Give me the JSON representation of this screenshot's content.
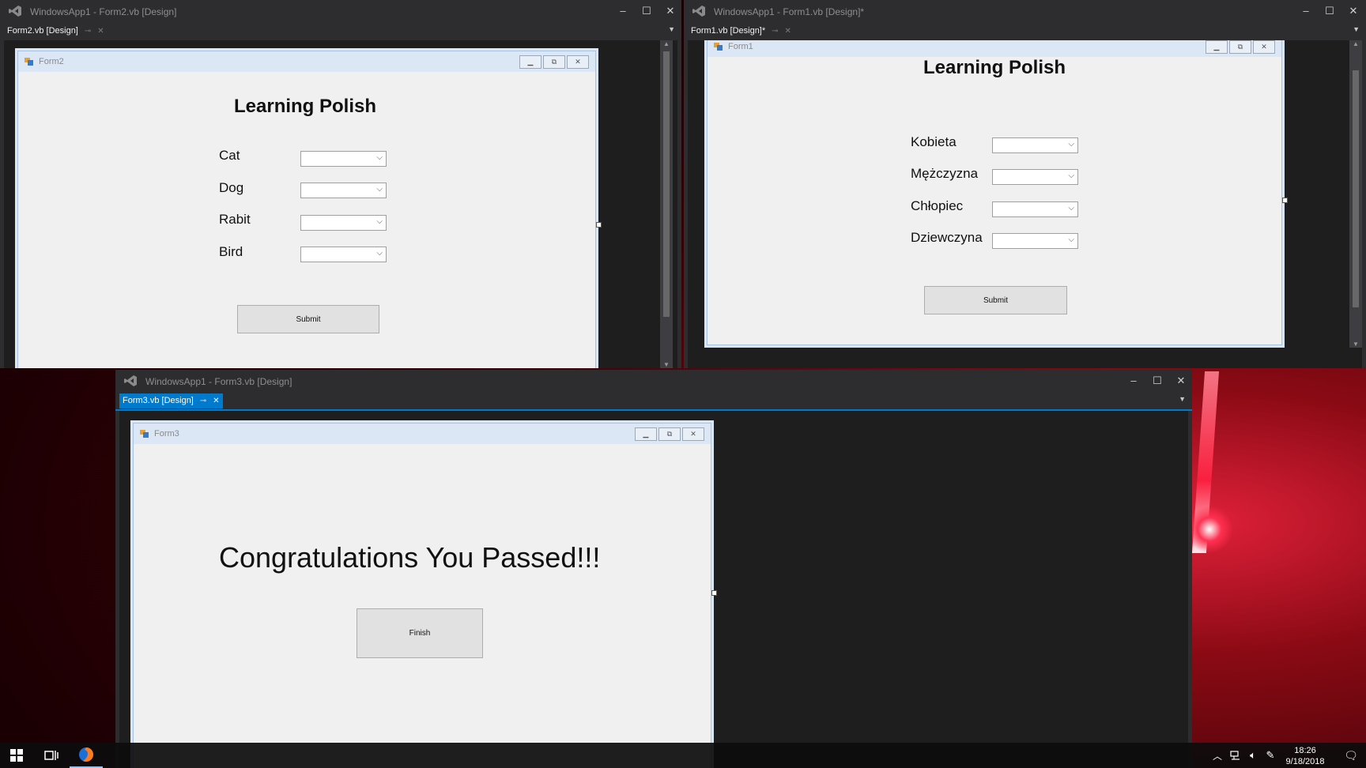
{
  "win_form2": {
    "title": "WindowsApp1 - Form2.vb [Design]",
    "tab": "Form2.vb [Design]",
    "form": {
      "name": "Form2",
      "heading": "Learning Polish",
      "labels": [
        "Cat",
        "Dog",
        "Rabit",
        "Bird"
      ],
      "submit": "Submit"
    }
  },
  "win_form1": {
    "title": "WindowsApp1 - Form1.vb [Design]*",
    "tab": "Form1.vb [Design]*",
    "form": {
      "name": "Form1",
      "heading": "Learning Polish",
      "labels": [
        "Kobieta",
        "Mężczyzna",
        "Chłopiec",
        "Dziewczyna"
      ],
      "submit": "Submit"
    }
  },
  "win_form3": {
    "title": "WindowsApp1 - Form3.vb [Design]",
    "tab": "Form3.vb [Design]",
    "form": {
      "name": "Form3",
      "heading": "Congratulations You Passed!!!",
      "finish": "Finish"
    }
  },
  "window_controls": {
    "minimize": "‒",
    "maximize": "☐",
    "close": "✕"
  },
  "taskbar": {
    "time": "18:26",
    "date": "9/18/2018",
    "icons": [
      "windows-start-icon",
      "task-view-icon",
      "firefox-icon",
      "chevron-up-icon",
      "network-icon",
      "volume-icon",
      "pen-icon",
      "notifications-icon"
    ]
  },
  "colors": {
    "vs_chrome": "#2d2d30",
    "vs_accent": "#007acc",
    "form_bg": "#f0f0f0",
    "wallpaper_red": "#c0101e"
  }
}
